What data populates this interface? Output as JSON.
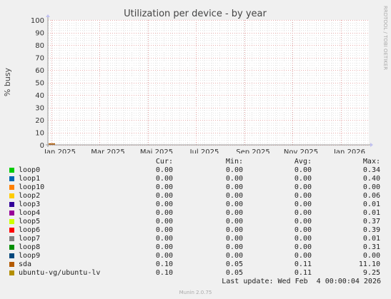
{
  "chart_data": {
    "type": "area",
    "title": "Utilization per device - by year",
    "ylabel": "% busy",
    "xlabel": "",
    "ylim": [
      0,
      100
    ],
    "yticks": [
      0,
      10,
      20,
      30,
      40,
      50,
      60,
      70,
      80,
      90,
      100
    ],
    "xticks": [
      "Jan 2025",
      "Mar 2025",
      "Mai 2025",
      "Jul 2025",
      "Sep 2025",
      "Nov 2025",
      "Jan 2026"
    ],
    "grid": true,
    "series_colors": {
      "loop0": "#00cc00",
      "loop1": "#0066b3",
      "loop10": "#ff8000",
      "loop2": "#ffcc00",
      "loop3": "#330099",
      "loop4": "#990099",
      "loop5": "#ccff00",
      "loop6": "#ff0000",
      "loop7": "#808080",
      "loop8": "#008f00",
      "loop9": "#00487d",
      "sda": "#b35a00",
      "ubuntu-vg/ubuntu-lv": "#b38f00"
    },
    "visible_activity": [
      {
        "series": "sda",
        "x_start": "Jan 2025",
        "level": 11.1,
        "span_fraction": 0.02
      }
    ]
  },
  "vendor_text": "RRDTOOL / TOBI OETIKER",
  "legend": {
    "headers": {
      "cur": "Cur:",
      "min": "Min:",
      "avg": "Avg:",
      "max": "Max:"
    },
    "rows": [
      {
        "name": "loop0",
        "color": "#00cc00",
        "cur": "0.00",
        "min": "0.00",
        "avg": "0.00",
        "max": "0.34"
      },
      {
        "name": "loop1",
        "color": "#0066b3",
        "cur": "0.00",
        "min": "0.00",
        "avg": "0.00",
        "max": "0.40"
      },
      {
        "name": "loop10",
        "color": "#ff8000",
        "cur": "0.00",
        "min": "0.00",
        "avg": "0.00",
        "max": "0.00"
      },
      {
        "name": "loop2",
        "color": "#ffcc00",
        "cur": "0.00",
        "min": "0.00",
        "avg": "0.00",
        "max": "0.06"
      },
      {
        "name": "loop3",
        "color": "#330099",
        "cur": "0.00",
        "min": "0.00",
        "avg": "0.00",
        "max": "0.01"
      },
      {
        "name": "loop4",
        "color": "#990099",
        "cur": "0.00",
        "min": "0.00",
        "avg": "0.00",
        "max": "0.01"
      },
      {
        "name": "loop5",
        "color": "#ccff00",
        "cur": "0.00",
        "min": "0.00",
        "avg": "0.00",
        "max": "0.37"
      },
      {
        "name": "loop6",
        "color": "#ff0000",
        "cur": "0.00",
        "min": "0.00",
        "avg": "0.00",
        "max": "0.39"
      },
      {
        "name": "loop7",
        "color": "#808080",
        "cur": "0.00",
        "min": "0.00",
        "avg": "0.00",
        "max": "0.01"
      },
      {
        "name": "loop8",
        "color": "#008f00",
        "cur": "0.00",
        "min": "0.00",
        "avg": "0.00",
        "max": "0.31"
      },
      {
        "name": "loop9",
        "color": "#00487d",
        "cur": "0.00",
        "min": "0.00",
        "avg": "0.00",
        "max": "0.00"
      },
      {
        "name": "sda",
        "color": "#b35a00",
        "cur": "0.10",
        "min": "0.05",
        "avg": "0.11",
        "max": "11.10"
      },
      {
        "name": "ubuntu-vg/ubuntu-lv",
        "color": "#b38f00",
        "cur": "0.10",
        "min": "0.05",
        "avg": "0.11",
        "max": "9.25"
      }
    ]
  },
  "last_update": "Last update: Wed Feb  4 00:00:04 2026",
  "footer": "Munin 2.0.75"
}
